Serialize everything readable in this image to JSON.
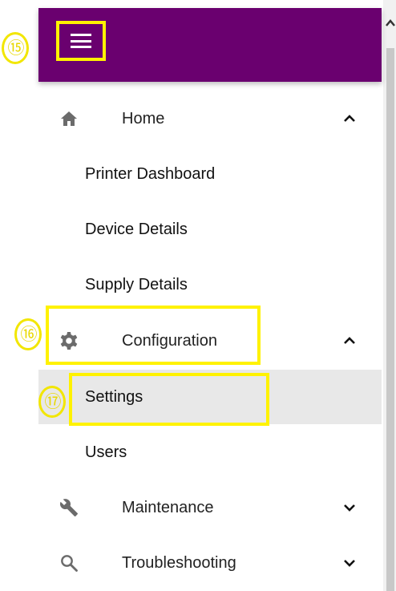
{
  "header": {
    "menu_icon": "hamburger-menu-icon",
    "background": "#6a006f"
  },
  "callouts": {
    "menu": "⑮",
    "configuration": "⑯",
    "settings": "⑰"
  },
  "annotation_color": "#fff200",
  "nav": {
    "home": {
      "label": "Home",
      "icon": "home-icon",
      "expanded": true,
      "children": [
        "Printer Dashboard",
        "Device Details",
        "Supply Details"
      ]
    },
    "configuration": {
      "label": "Configuration",
      "icon": "gear-icon",
      "expanded": true,
      "children": [
        "Settings",
        "Users"
      ],
      "selected_child": "Settings"
    },
    "maintenance": {
      "label": "Maintenance",
      "icon": "wrench-icon",
      "expanded": false
    },
    "troubleshooting": {
      "label": "Troubleshooting",
      "icon": "search-icon",
      "expanded": false
    }
  }
}
